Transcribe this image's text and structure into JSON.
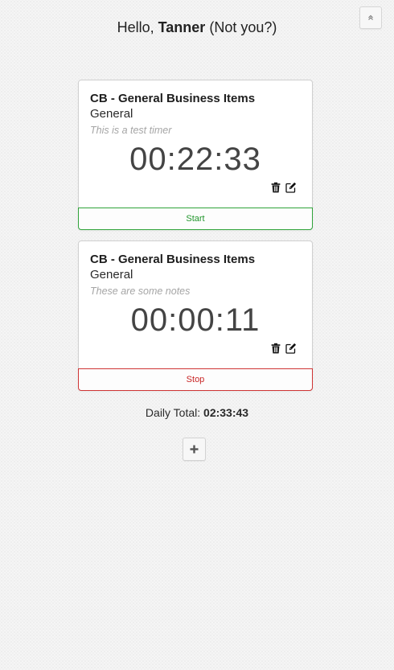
{
  "header": {
    "greeting_prefix": "Hello, ",
    "username": "Tanner",
    "not_you": " (Not you?)",
    "collapse_icon": "double-chevron-up-icon"
  },
  "timers": [
    {
      "project": "CB - General Business Items",
      "category": "General",
      "notes": "This is a test timer",
      "time": "00:22:33",
      "action_label": "Start",
      "action_color": "#22962d"
    },
    {
      "project": "CB - General Business Items",
      "category": "General",
      "notes": "These are some notes",
      "time": "00:00:11",
      "action_label": "Stop",
      "action_color": "#c82525"
    }
  ],
  "icons": {
    "delete": "trash-icon",
    "edit": "edit-icon",
    "add": "plus-icon"
  },
  "footer": {
    "daily_total_label": "Daily Total: ",
    "daily_total_value": "02:33:43"
  },
  "colors": {
    "start": "#2fa33a",
    "stop": "#cf3434",
    "time_text": "#444444",
    "notes_text": "#a5a5a5"
  }
}
